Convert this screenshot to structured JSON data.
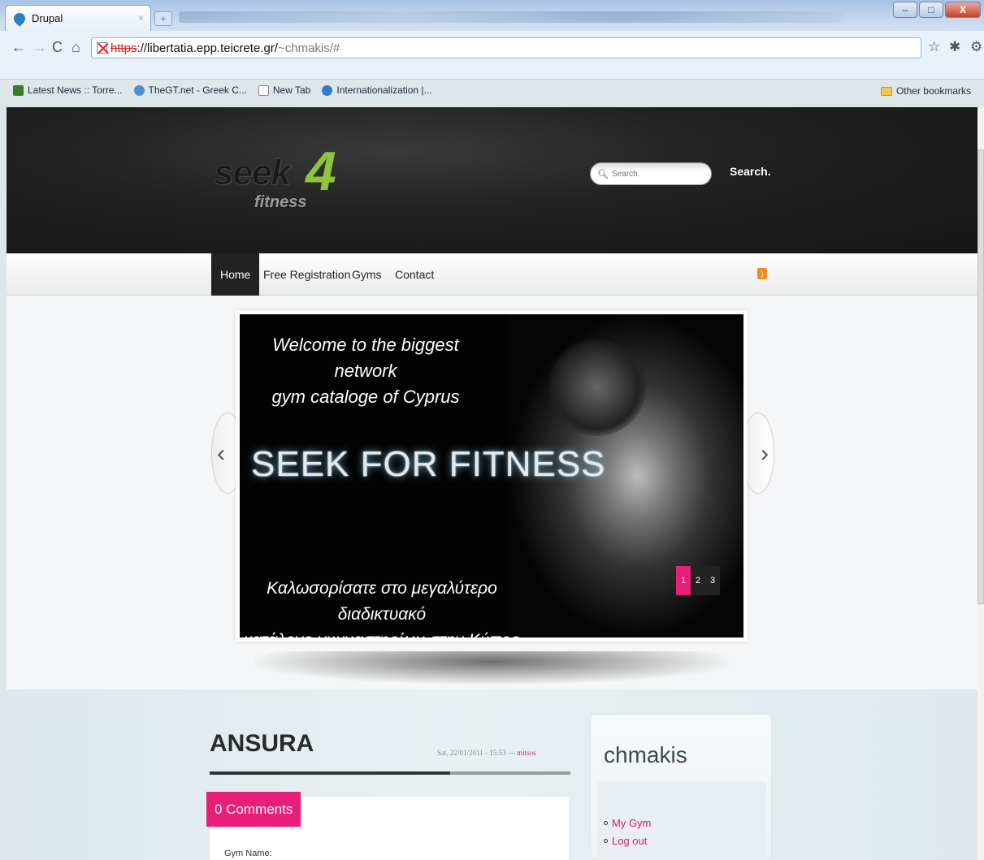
{
  "browser": {
    "tab_title": "Drupal",
    "tab_close": "×",
    "new_tab": "+",
    "url_scheme": "https",
    "url_host": "://libertatia.epp.teicrete.gr/",
    "url_path": "~chmakis/#",
    "bookmarks": [
      {
        "label": "Latest News :: Torre...",
        "color": "#3b7a2a"
      },
      {
        "label": "TheGT.net - Greek C...",
        "color": "#4a8fd6"
      },
      {
        "label": "New Tab",
        "color": "#ffffff"
      },
      {
        "label": "Internationalization |...",
        "color": "#2f7fc4"
      }
    ],
    "other_bookmarks": "Other bookmarks"
  },
  "site": {
    "logo_seek": "seek",
    "logo_four": "4",
    "logo_fitness": "fitness",
    "search_placeholder": "Search.",
    "search_link": "Search.",
    "accent": "#e91e79",
    "logo_green": "#8cc63f"
  },
  "menu": [
    {
      "label": "Home",
      "active": true
    },
    {
      "label": "Free Registration"
    },
    {
      "label": "Gyms"
    },
    {
      "label": "Contact"
    }
  ],
  "slider": {
    "tagline_line1": "Welcome to the biggest network",
    "tagline_line2": "gym cataloge of Cyprus",
    "big_text": "SEEK FOR FITNESS",
    "greek_line1": "Καλωσορίσατε στο μεγαλύτερο διαδικτυακό",
    "greek_line2": "κατάλογο γυμναστηρίων στην Κύπρο",
    "pages": [
      "1",
      "2",
      "3"
    ],
    "current_page": "1",
    "prev_arrow": "‹",
    "next_arrow": "›"
  },
  "article": {
    "title": "ANSURA",
    "date": "Sat, 22/01/2011 - 15:53 — ",
    "author": "mitsos",
    "comments": "0 Comments",
    "field_label": "Gym Name:"
  },
  "sidebar": {
    "title": "chmakis",
    "links": [
      "My Gym",
      "Log out"
    ]
  }
}
